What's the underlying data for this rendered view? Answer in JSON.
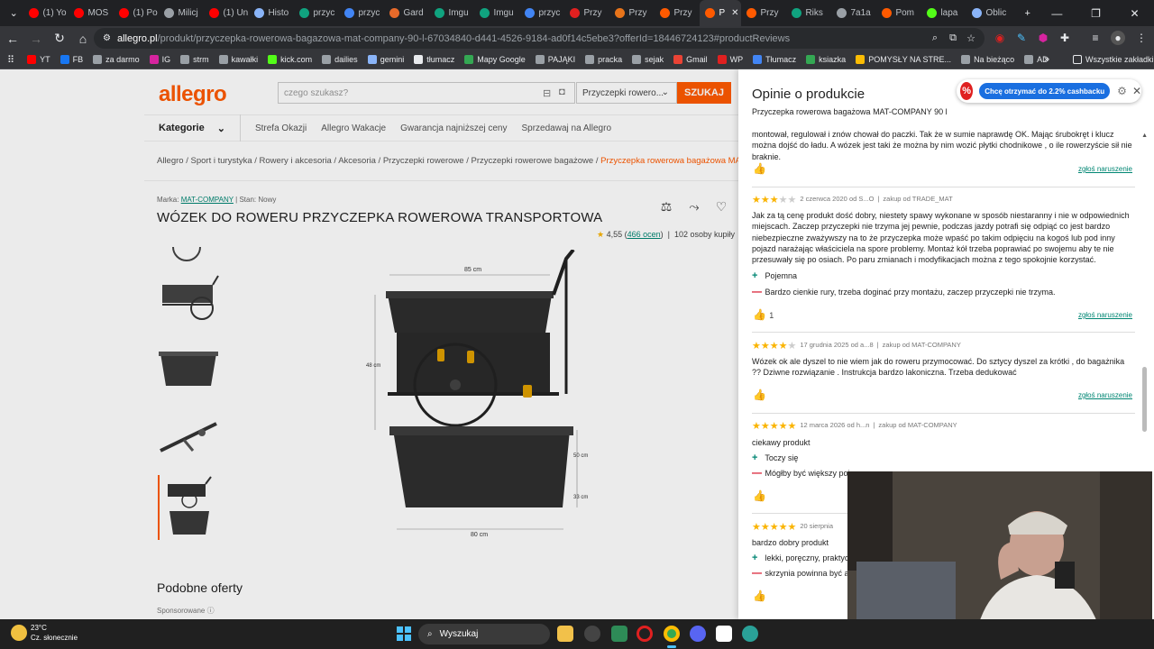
{
  "browser": {
    "tabs": [
      {
        "label": "(1) Yo",
        "icon": "youtube-icon",
        "color": "#ff0000"
      },
      {
        "label": "MOS",
        "icon": "youtube-icon",
        "color": "#ff0000"
      },
      {
        "label": "(1) Po",
        "icon": "youtube-icon",
        "color": "#ff0000"
      },
      {
        "label": "Milicj",
        "icon": "globe-icon",
        "color": "#9aa0a6"
      },
      {
        "label": "(1) Un",
        "icon": "youtube-icon",
        "color": "#ff0000"
      },
      {
        "label": "Histo",
        "icon": "clock-icon",
        "color": "#8ab4f8"
      },
      {
        "label": "przyc",
        "icon": "chatgpt-icon",
        "color": "#10a37f"
      },
      {
        "label": "przyc",
        "icon": "google-icon",
        "color": "#4285f4"
      },
      {
        "label": "Gard",
        "icon": "copilot-icon",
        "color": "#e86a2a"
      },
      {
        "label": "Imgu",
        "icon": "chatgpt-icon",
        "color": "#10a37f"
      },
      {
        "label": "Imgu",
        "icon": "chatgpt-icon",
        "color": "#10a37f"
      },
      {
        "label": "przyc",
        "icon": "google-icon",
        "color": "#4285f4"
      },
      {
        "label": "Przy",
        "icon": "shop-icon",
        "color": "#e02020"
      },
      {
        "label": "Przy",
        "icon": "c-icon",
        "color": "#e8741a"
      },
      {
        "label": "Przy",
        "icon": "allegro-icon",
        "color": "#ff5a00"
      },
      {
        "label": "P",
        "icon": "allegro-icon",
        "color": "#ff5a00",
        "active": true
      },
      {
        "label": "Przy",
        "icon": "allegro-icon",
        "color": "#ff5a00"
      },
      {
        "label": "Riks",
        "icon": "chatgpt-icon",
        "color": "#10a37f"
      },
      {
        "label": "7a1a",
        "icon": "globe-icon",
        "color": "#9aa0a6"
      },
      {
        "label": "Pom",
        "icon": "allegro-icon",
        "color": "#ff5a00"
      },
      {
        "label": "lapa",
        "icon": "kick-icon",
        "color": "#53fc18"
      },
      {
        "label": "Oblic",
        "icon": "gemini-icon",
        "color": "#8ab4f8"
      }
    ],
    "url_host": "allegro.pl",
    "url_path": "/produkt/przyczepka-rowerowa-bagazowa-mat-company-90-l-67034840-d441-4526-9184-ad0f14c5ebe3?offerId=18446724123#productReviews",
    "bookmarks": [
      {
        "label": "YT",
        "color": "#ff0000"
      },
      {
        "label": "FB",
        "color": "#1877f2"
      },
      {
        "label": "za darmo",
        "color": "#9aa0a6"
      },
      {
        "label": "IG",
        "color": "#d6249f"
      },
      {
        "label": "strm",
        "color": "#9aa0a6"
      },
      {
        "label": "kawałki",
        "color": "#9aa0a6"
      },
      {
        "label": "kick.com",
        "color": "#53fc18"
      },
      {
        "label": "dailies",
        "color": "#9aa0a6"
      },
      {
        "label": "gemini",
        "color": "#8ab4f8"
      },
      {
        "label": "tłumacz",
        "color": "#e8eaed"
      },
      {
        "label": "Mapy Google",
        "color": "#34a853"
      },
      {
        "label": "PAJĄKI",
        "color": "#9aa0a6"
      },
      {
        "label": "pracka",
        "color": "#9aa0a6"
      },
      {
        "label": "sejak",
        "color": "#9aa0a6"
      },
      {
        "label": "Gmail",
        "color": "#ea4335"
      },
      {
        "label": "WP",
        "color": "#e02020"
      },
      {
        "label": "Tłumacz",
        "color": "#4285f4"
      },
      {
        "label": "ksiazka",
        "color": "#34a853"
      },
      {
        "label": "POMYSŁY NA STRE...",
        "color": "#fbbc04"
      },
      {
        "label": "Na bieżąco",
        "color": "#9aa0a6"
      },
      {
        "label": "AD",
        "color": "#9aa0a6"
      }
    ],
    "bookmarks_more": "»",
    "all_bookmarks": "Wszystkie zakładki"
  },
  "site": {
    "logo": "allegro",
    "search_placeholder": "czego szukasz?",
    "category_select": "Przyczepki rowero...",
    "search_button": "SZUKAJ",
    "nav": {
      "categories": "Kategorie",
      "items": [
        "Strefa Okazji",
        "Allegro Wakacje",
        "Gwarancja najniższej ceny",
        "Sprzedawaj na Allegro"
      ]
    },
    "breadcrumbs": [
      "Allegro",
      "Sport i turystyka",
      "Rowery i akcesoria",
      "Akcesoria",
      "Przyczepki rowerowe",
      "Przyczepki rowerowe bagażowe"
    ],
    "breadcrumb_current": "Przyczepka rowerowa bagażowa MAT-COM",
    "product": {
      "brand_label": "Marka:",
      "brand": "MAT-COMPANY",
      "condition_label": "Stan:",
      "condition": "Nowy",
      "title": "WÓZEK DO ROWERU PRZYCZEPKA ROWEROWA TRANSPORTOWA",
      "rating": "4,55",
      "ratings_count": "466 ocen",
      "buyers": "102 osoby kupiły",
      "dims": {
        "width": "85 cm",
        "height": "48 cm",
        "box_width": "80 cm",
        "box_h1": "50 cm",
        "box_h2": "33 cm"
      }
    },
    "similar_title": "Podobne oferty",
    "sponsored": "Sponsorowane"
  },
  "reviews_panel": {
    "title": "Opinie o produkcie",
    "subtitle": "Przyczepka rowerowa bagażowa MAT-COMPANY 90 l",
    "report_label": "zgłoś naruszenie",
    "review0": {
      "text": "montował, regulował i znów chował do paczki. Tak że w sumie naprawdę OK. Mając śrubokręt i klucz można dojść do ładu. A wózek jest taki że można by nim wozić płytki chodnikowe , o ile rowerzyście sił nie braknie."
    },
    "review1": {
      "stars": 3,
      "date": "2 czerwca 2020 od S...O",
      "source": "zakup od TRADE_MAT",
      "text": "Jak za tą cenę produkt dość dobry, niestety spawy wykonane w sposób niestaranny i nie w odpowiednich miejscach. Zaczep przyczepki nie trzyma jej pewnie, podczas jazdy potrafi się odpiąć co jest bardzo niebezpieczne zważywszy na to że przyczepka może wpaść po takim odpięciu na kogoś lub pod inny pojazd narażając właściciela na spore problemy. Montaż kół trzeba poprawiać po swojemu aby te nie przesuwały się po osiach. Po paru zmianach i modyfikacjach można z tego spokojnie korzystać.",
      "pro": "Pojemna",
      "con": "Bardzo cienkie rury, trzeba doginać przy montażu, zaczep przyczepki nie trzyma.",
      "likes": "1"
    },
    "review2": {
      "stars": 4,
      "date": "17 grudnia 2025 od a...8",
      "source": "zakup od MAT-COMPANY",
      "text": "Wózek ok ale dyszel to nie wiem jak do roweru przymocować. Do sztycy dyszel za krótki , do bagażnika ?? Dziwne rozwiązanie . Instrukcja bardzo lakoniczna. Trzeba dedukować"
    },
    "review3": {
      "stars": 5,
      "date": "12 marca 2026 od h...n",
      "source": "zakup od MAT-COMPANY",
      "text": "ciekawy produkt",
      "pro": "Toczy się",
      "con": "Mógłby być większy poj"
    },
    "review4": {
      "stars": 5,
      "date": "20 sierpnia",
      "text": "bardzo dobry produkt",
      "pro": "lekki, poręczny, praktyc",
      "con": "skrzynia powinna być a"
    }
  },
  "cashback": {
    "button": "Chcę otrzymać do 2.2% cashbacku"
  },
  "taskbar": {
    "temp": "23°C",
    "weather": "Cz. słonecznie",
    "search": "Wyszukaj"
  }
}
